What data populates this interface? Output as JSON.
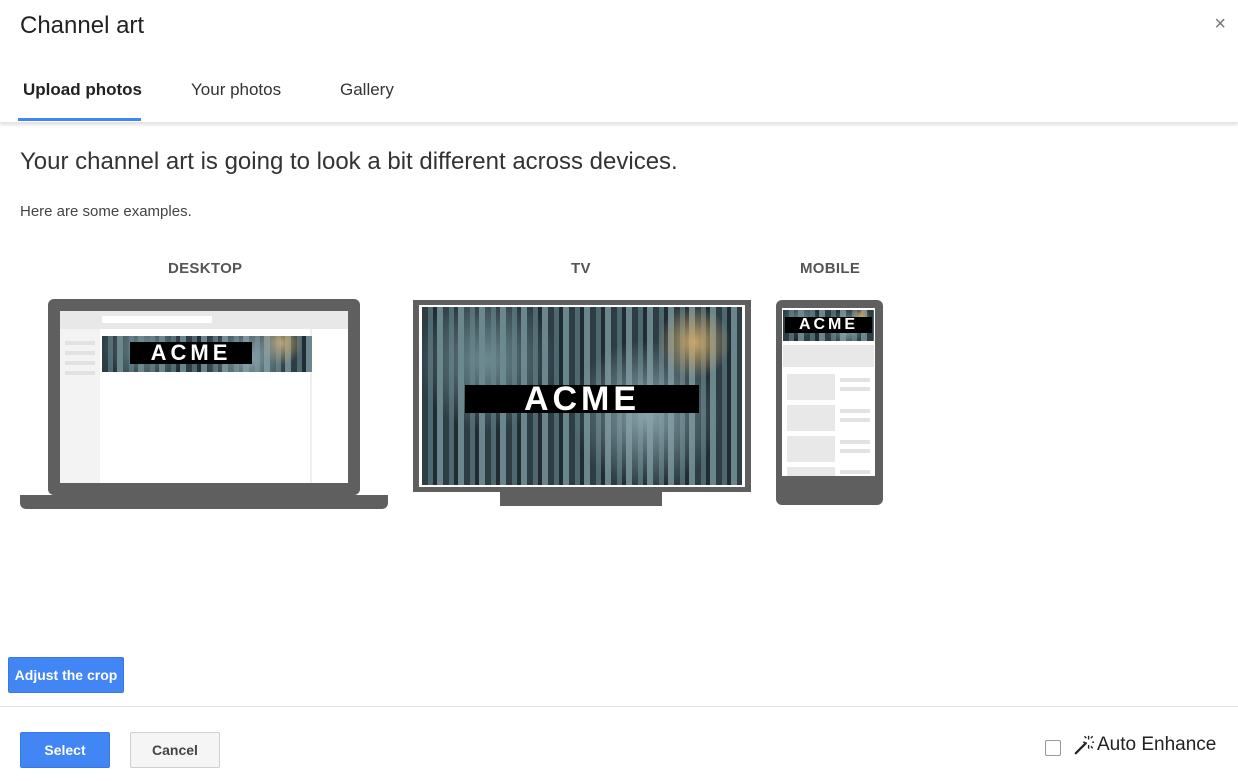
{
  "dialog": {
    "title": "Channel art",
    "close_symbol": "×"
  },
  "tabs": [
    {
      "label": "Upload photos",
      "active": true
    },
    {
      "label": "Your photos",
      "active": false
    },
    {
      "label": "Gallery",
      "active": false
    }
  ],
  "content": {
    "headline": "Your channel art is going to look a bit different across devices.",
    "subtext": "Here are some examples."
  },
  "devices": [
    {
      "label": "DESKTOP",
      "banner_text": "ACME"
    },
    {
      "label": "TV",
      "banner_text": "ACME"
    },
    {
      "label": "MOBILE",
      "banner_text": "ACME"
    }
  ],
  "buttons": {
    "adjust_crop": "Adjust the crop",
    "select": "Select",
    "cancel": "Cancel"
  },
  "auto_enhance": {
    "label": "Auto Enhance",
    "checked": false,
    "icon": "magic-wand-icon"
  },
  "colors": {
    "accent": "#4285f4",
    "device_frame": "#5f5f5f"
  }
}
